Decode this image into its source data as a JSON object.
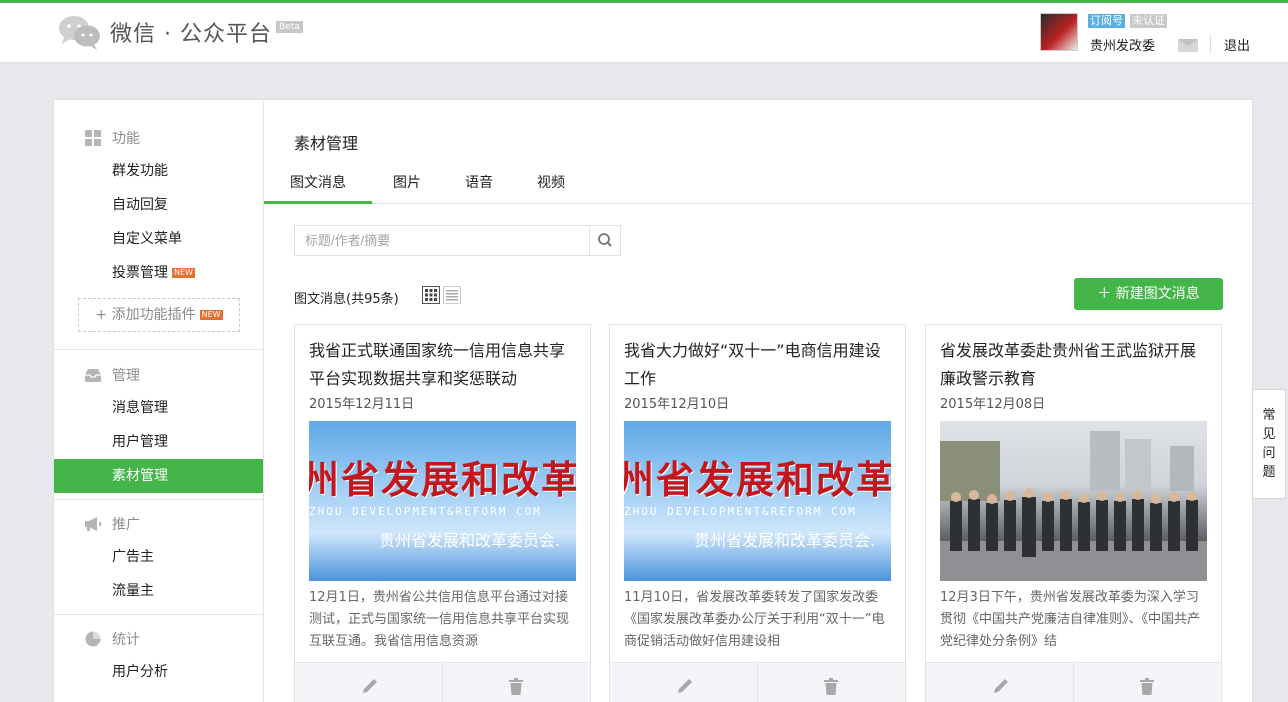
{
  "header": {
    "logo_text": "微信 · 公众平台",
    "beta": "Beta",
    "account": {
      "type_tag": "订阅号",
      "verify_tag": "未认证",
      "name": "贵州发改委",
      "logout": "退出"
    }
  },
  "sidebar": {
    "sections": [
      {
        "title": "功能",
        "icon": "grid-icon",
        "items": [
          "群发功能",
          "自动回复",
          "自定义菜单",
          "投票管理"
        ]
      },
      {
        "title": "管理",
        "icon": "inbox-icon",
        "items": [
          "消息管理",
          "用户管理",
          "素材管理"
        ]
      },
      {
        "title": "推广",
        "icon": "megaphone-icon",
        "items": [
          "广告主",
          "流量主"
        ]
      },
      {
        "title": "统计",
        "icon": "pie-chart-icon",
        "items": [
          "用户分析"
        ]
      }
    ],
    "new_badge": "NEW",
    "add_plugin": "添加功能插件",
    "active_item": "素材管理"
  },
  "main": {
    "title": "素材管理",
    "tabs": [
      "图文消息",
      "图片",
      "语音",
      "视频"
    ],
    "active_tab": "图文消息",
    "search": {
      "placeholder": "标题/作者/摘要"
    },
    "count_label": "图文消息(共95条)",
    "new_button": "新建图文消息",
    "cards": [
      {
        "title": "我省正式联通国家统一信用信息共享平台实现数据共享和奖惩联动",
        "date": "2015年12月11日",
        "image_big": "州省发展和改革委",
        "image_en": "ZHOU DEVELOPMENT&REFORM COM",
        "image_cn": "贵州省发展和改革委员会.",
        "desc": "12月1日，贵州省公共信用信息平台通过对接测试，正式与国家统一信用信息共享平台实现互联互通。我省信用信息资源"
      },
      {
        "title": "我省大力做好“双十一”电商信用建设工作",
        "date": "2015年12月10日",
        "image_big": "州省发展和改革委",
        "image_en": "ZHOU DEVELOPMENT&REFORM COM",
        "image_cn": "贵州省发展和改革委员会.",
        "desc": "11月10日，省发展改革委转发了国家发改委《国家发展改革委办公厅关于利用“双十一”电商促销活动做好信用建设相"
      },
      {
        "title": "省发展改革委赴贵州省王武监狱开展廉政警示教育",
        "date": "2015年12月08日",
        "desc": "12月3日下午，贵州省发展改革委为深入学习贯彻《中国共产党廉洁自律准则》、《中国共产党纪律处分条例》结"
      }
    ]
  },
  "faq": [
    "常",
    "见",
    "问",
    "题"
  ],
  "colors": {
    "accent": "#44b549",
    "badge": "#e6702d"
  }
}
